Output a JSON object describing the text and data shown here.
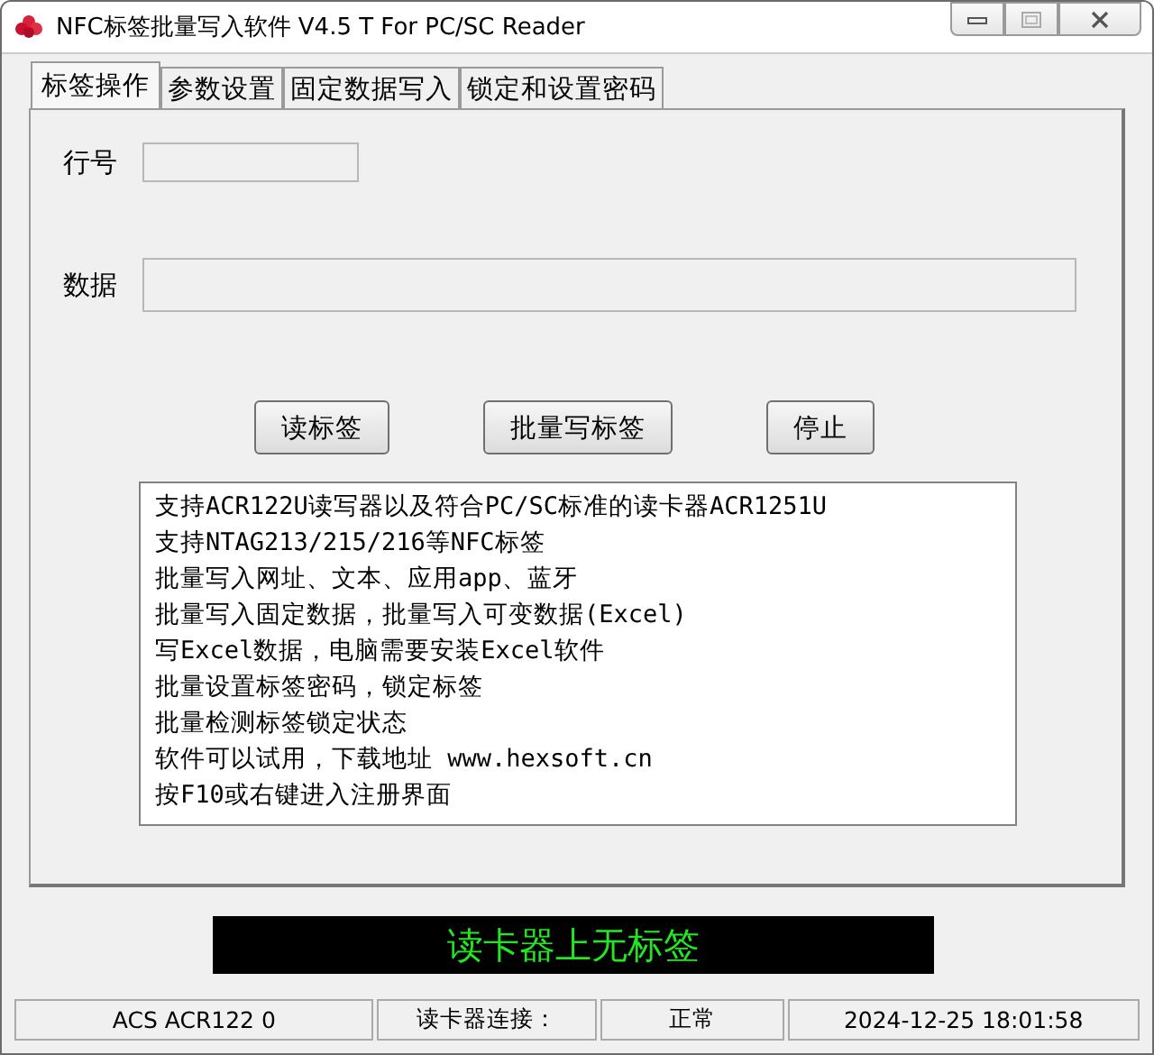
{
  "window": {
    "title": "NFC标签批量写入软件 V4.5 T For PC/SC Reader"
  },
  "tabs": [
    {
      "label": "标签操作",
      "selected": true
    },
    {
      "label": "参数设置",
      "selected": false
    },
    {
      "label": "固定数据写入",
      "selected": false
    },
    {
      "label": "锁定和设置密码",
      "selected": false
    }
  ],
  "fields": [
    {
      "label": "行号",
      "kind": "short"
    },
    {
      "label": "数据",
      "kind": "long"
    }
  ],
  "buttons": [
    "读标签",
    "批量写标签",
    "停止"
  ],
  "info_lines": [
    "支持ACR122U读写器以及符合PC/SC标准的读卡器ACR1251U",
    "支持NTAG213/215/216等NFC标签",
    "批量写入网址、文本、应用app、蓝牙",
    "批量写入固定数据，批量写入可变数据(Excel)",
    "写Excel数据，电脑需要安装Excel软件",
    "批量设置标签密码，锁定标签",
    "批量检测标签锁定状态",
    "软件可以试用，下载地址 www.hexsoft.cn",
    "按F10或右键进入注册界面"
  ],
  "message": "读卡器上无标签",
  "status_bar": [
    "ACS ACR122 0",
    "读卡器连接：",
    "正常",
    "2024-12-25 18:01:58"
  ]
}
